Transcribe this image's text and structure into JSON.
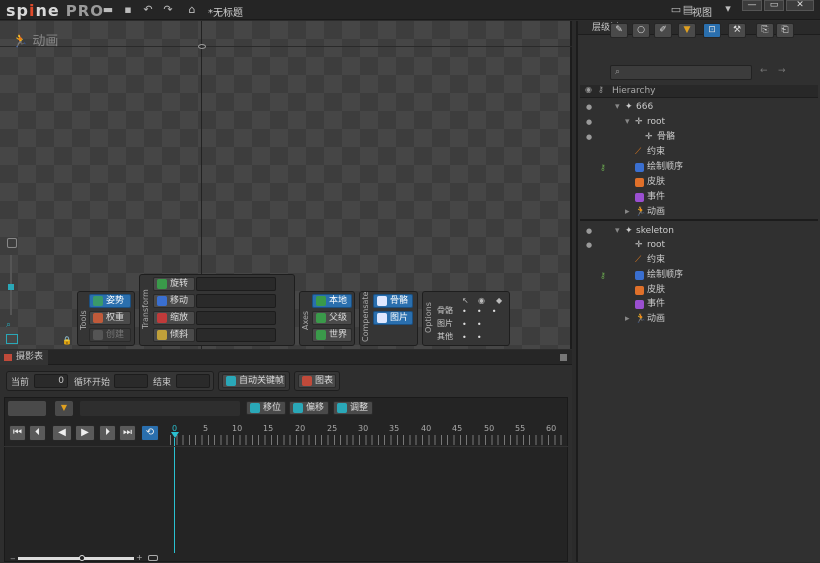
{
  "app": {
    "logo": "sp",
    "logo_accent": "i",
    "logo_rest": "ne",
    "edition": "PRO",
    "doc_title": "*无标题",
    "view_menu": "视图"
  },
  "viewport": {
    "mode_label": "动画"
  },
  "tools": {
    "label": "Tools",
    "pose": "姿势",
    "weights": "权重",
    "create": "创建"
  },
  "transform": {
    "label": "Transform",
    "rotate": "旋转",
    "translate": "移动",
    "scale": "缩放",
    "shear": "倾斜"
  },
  "axes": {
    "label": "Axes",
    "local": "本地",
    "parent": "父级",
    "world": "世界"
  },
  "compensate": {
    "label": "Compensate",
    "bones": "骨骼",
    "images": "图片"
  },
  "options": {
    "label": "Options",
    "rows": [
      "骨骼",
      "图片",
      "其他"
    ]
  },
  "dopesheet": {
    "tab": "摄影表",
    "current_label": "当前",
    "current_value": "0",
    "loop_start": "循环开始",
    "end_label": "结束",
    "auto_key": "自动关键帧",
    "graph": "图表",
    "offset": "移位",
    "shift": "偏移",
    "adjust": "调整",
    "ticks": [
      "0",
      "5",
      "10",
      "15",
      "20",
      "25",
      "30",
      "35",
      "40",
      "45",
      "50",
      "55",
      "60"
    ]
  },
  "tree": {
    "tab": "层级树",
    "header": "Hierarchy",
    "rows": [
      "666",
      "root",
      "骨骼",
      "约束",
      "绘制顺序",
      "皮肤",
      "事件",
      "动画",
      "skeleton",
      "root",
      "约束",
      "绘制顺序",
      "皮肤",
      "事件",
      "动画"
    ]
  },
  "colors": {
    "accent": "#2a6fae",
    "constraint": "#e07a1f",
    "draw_order": "#3a6fd0",
    "skin": "#e0702a",
    "event": "#9a4fd0"
  }
}
